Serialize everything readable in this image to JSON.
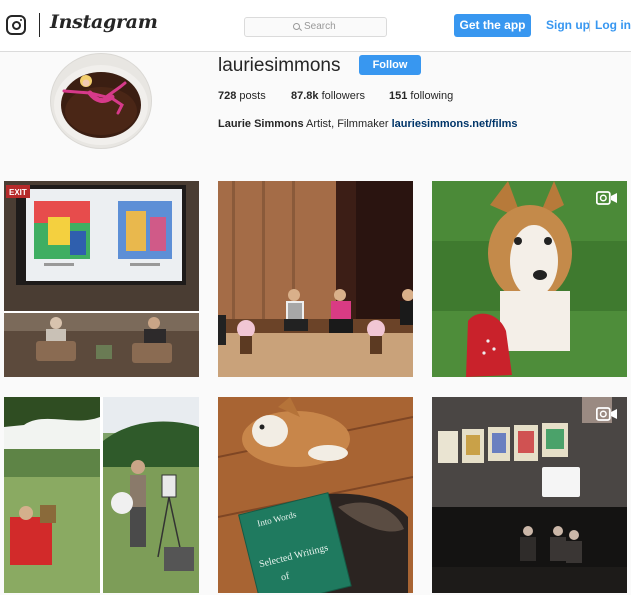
{
  "nav": {
    "logo_icon": "instagram-glyph-icon",
    "wordmark": "Instagram",
    "search_placeholder": "Search",
    "get_app_label": "Get the app",
    "signup_label": "Sign up",
    "separator": "|",
    "login_label": "Log in"
  },
  "profile": {
    "username": "lauriesimmons",
    "follow_label": "Follow",
    "posts": "728",
    "posts_label": "posts",
    "followers": "87.8k",
    "followers_label": "followers",
    "following": "151",
    "following_label": "following",
    "full_name": "Laurie Simmons",
    "bio_text": "Artist, Filmmaker",
    "bio_link": "lauriesimmons.net/films"
  },
  "posts": [
    {
      "subject": "lecture-slide-and-panel",
      "has_video": false,
      "sign_text": "EXIT"
    },
    {
      "subject": "panel-discussion-stage",
      "has_video": false
    },
    {
      "subject": "collie-puppy-on-grass",
      "has_video": true
    },
    {
      "subject": "painters-in-landscape",
      "has_video": false
    },
    {
      "subject": "puppy-and-book",
      "has_video": false,
      "book_text_1": "Into Words",
      "book_text_2": "Selected Writings",
      "book_text_3": "of"
    },
    {
      "subject": "tarot-cards-and-stage",
      "has_video": true
    }
  ],
  "colors": {
    "accent": "#3897f0",
    "background": "#fafafa",
    "text": "#262626",
    "link_dark": "#003569"
  }
}
